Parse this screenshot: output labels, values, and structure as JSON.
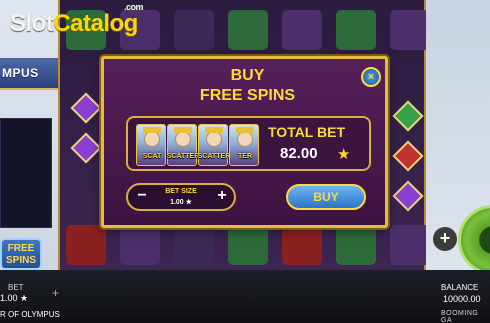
{
  "watermark": {
    "slot": "Slot",
    "catalog": "Catalog",
    "com": ".com"
  },
  "game": {
    "logo_text": "MPUS",
    "name": "R OF OLYMPUS",
    "provider": "BOOMING GA"
  },
  "side": {
    "buy_free_spins": "FREE\nSPINS"
  },
  "footer": {
    "bet_label": "BET",
    "bet_value": "1.00 ★",
    "balance_label": "BALANCE",
    "balance_value": "10000.00"
  },
  "modal": {
    "title_line1": "BUY",
    "title_line2": "FREE SPINS",
    "close_label": "×",
    "scatter_labels": [
      "SCAT",
      "SCATTER",
      "SCATTER",
      "TER"
    ],
    "total_bet_label": "TOTAL BET",
    "total_bet_value": "82.00",
    "star": "★",
    "bet_size_label": "BET SIZE",
    "bet_size_value": "1.00 ★",
    "minus": "−",
    "plus": "+",
    "buy_label": "BUY"
  },
  "controls": {
    "plus_label": "+"
  },
  "colors": {
    "gold": "#ffd938",
    "modal_bg": "#55205a",
    "button_blue": "#2a73c9",
    "border_gold": "#e6bc3a"
  },
  "icons": [
    "close-icon",
    "star-icon",
    "plus-icon",
    "minus-icon",
    "spin-icon"
  ]
}
